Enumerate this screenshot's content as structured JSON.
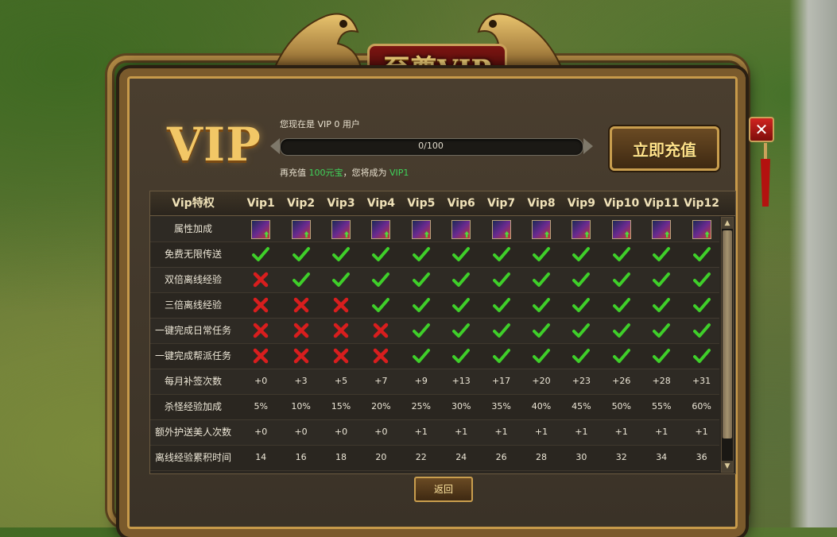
{
  "title": "至尊VIP",
  "logo_text": "VIP",
  "status": {
    "prefix": "您现在是 ",
    "level": "VIP 0",
    "suffix": " 用户"
  },
  "progress": {
    "text": "0/100",
    "fraction": 0
  },
  "recharge_line": {
    "prefix": "再充值 ",
    "amount": "100元宝",
    "middle": "，您将成为 ",
    "target": "VIP1"
  },
  "recharge_button": "立即充值",
  "close_icon": "close-icon",
  "back_button": "返回",
  "table": {
    "corner": "Vip特权",
    "levels": [
      "Vip1",
      "Vip2",
      "Vip3",
      "Vip4",
      "Vip5",
      "Vip6",
      "Vip7",
      "Vip8",
      "Vip9",
      "Vip10",
      "Vip11",
      "Vip12"
    ],
    "rows": [
      {
        "label": "属性加成",
        "type": "icon",
        "values": [
          "attr-icon",
          "attr-icon",
          "attr-icon",
          "attr-icon",
          "attr-icon",
          "attr-icon",
          "attr-icon",
          "attr-icon",
          "attr-icon",
          "attr-icon",
          "attr-icon",
          "attr-icon"
        ]
      },
      {
        "label": "免费无限传送",
        "type": "bool",
        "values": [
          true,
          true,
          true,
          true,
          true,
          true,
          true,
          true,
          true,
          true,
          true,
          true
        ]
      },
      {
        "label": "双倍离线经验",
        "type": "bool",
        "values": [
          false,
          true,
          true,
          true,
          true,
          true,
          true,
          true,
          true,
          true,
          true,
          true
        ]
      },
      {
        "label": "三倍离线经验",
        "type": "bool",
        "values": [
          false,
          false,
          false,
          true,
          true,
          true,
          true,
          true,
          true,
          true,
          true,
          true
        ]
      },
      {
        "label": "一键完成日常任务",
        "type": "bool",
        "values": [
          false,
          false,
          false,
          false,
          true,
          true,
          true,
          true,
          true,
          true,
          true,
          true
        ]
      },
      {
        "label": "一键完成帮派任务",
        "type": "bool",
        "values": [
          false,
          false,
          false,
          false,
          true,
          true,
          true,
          true,
          true,
          true,
          true,
          true
        ]
      },
      {
        "label": "每月补签次数",
        "type": "text",
        "values": [
          "+0",
          "+3",
          "+5",
          "+7",
          "+9",
          "+13",
          "+17",
          "+20",
          "+23",
          "+26",
          "+28",
          "+31"
        ]
      },
      {
        "label": "杀怪经验加成",
        "type": "text",
        "values": [
          "5%",
          "10%",
          "15%",
          "20%",
          "25%",
          "30%",
          "35%",
          "40%",
          "45%",
          "50%",
          "55%",
          "60%"
        ]
      },
      {
        "label": "额外护送美人次数",
        "type": "text",
        "values": [
          "+0",
          "+0",
          "+0",
          "+0",
          "+1",
          "+1",
          "+1",
          "+1",
          "+1",
          "+1",
          "+1",
          "+1"
        ]
      },
      {
        "label": "离线经验累积时间",
        "type": "text",
        "values": [
          "14",
          "16",
          "18",
          "20",
          "22",
          "24",
          "26",
          "28",
          "30",
          "32",
          "34",
          "36"
        ]
      }
    ]
  },
  "colors": {
    "gold": "#f4d27a",
    "green_text": "#3fd45a",
    "check": "#3fcf2a",
    "cross": "#d81e1e"
  }
}
